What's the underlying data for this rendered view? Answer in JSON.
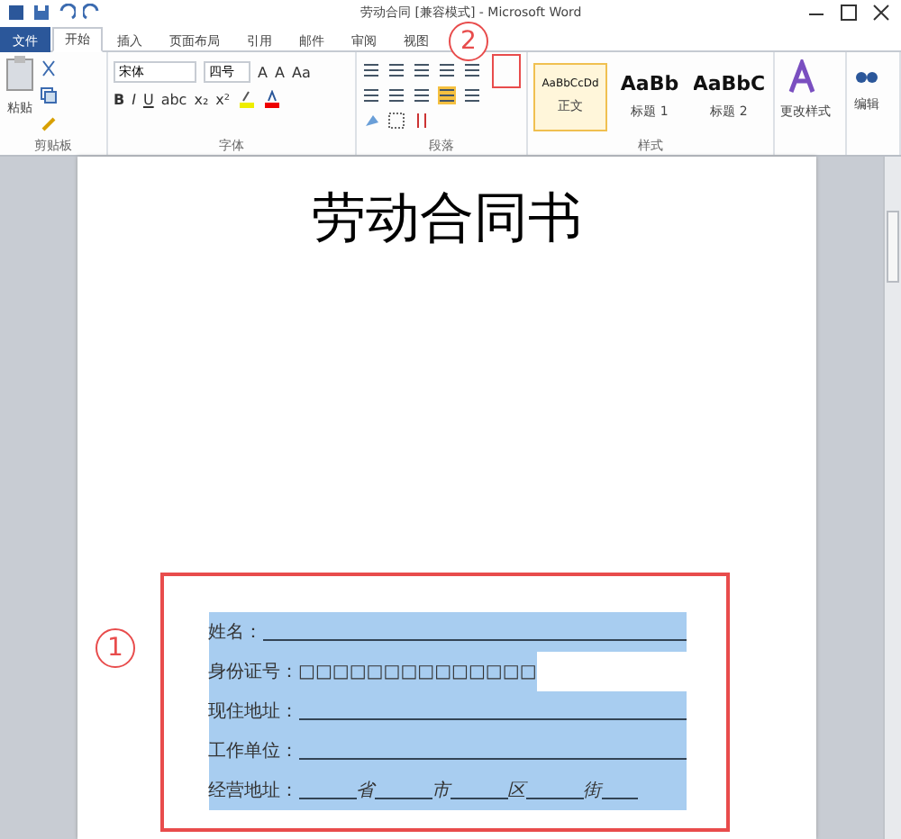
{
  "window": {
    "title": "劳动合同 [兼容模式] - Microsoft Word"
  },
  "tabs": [
    {
      "label": "文件",
      "kind": "file",
      "selected": false
    },
    {
      "label": "开始",
      "kind": "tab",
      "selected": true
    },
    {
      "label": "插入",
      "kind": "tab",
      "selected": false
    },
    {
      "label": "页面布局",
      "kind": "tab",
      "selected": false
    },
    {
      "label": "引用",
      "kind": "tab",
      "selected": false
    },
    {
      "label": "邮件",
      "kind": "tab",
      "selected": false
    },
    {
      "label": "审阅",
      "kind": "tab",
      "selected": false
    },
    {
      "label": "视图",
      "kind": "tab",
      "selected": false
    }
  ],
  "ribbon": {
    "clipboard": {
      "paste": "粘贴",
      "label": "剪贴板"
    },
    "font": {
      "name": "宋体",
      "size": "四号",
      "row1": [
        "A",
        "A",
        "Aa"
      ],
      "row2": [
        "B",
        "I",
        "U",
        "abc",
        "x₂",
        "x²"
      ],
      "label": "字体"
    },
    "paragraph": {
      "label": "段落"
    },
    "styles": {
      "items": [
        {
          "preview": "AaBbCcDd",
          "name": "正文",
          "selected": true
        },
        {
          "preview": "AaBb",
          "name": "标题 1",
          "selected": false
        },
        {
          "preview": "AaBbC",
          "name": "标题 2",
          "selected": false
        }
      ],
      "label": "样式"
    },
    "change_styles": "更改样式",
    "editing": "编辑"
  },
  "document": {
    "title": "劳动合同书",
    "form": {
      "selected": true,
      "rows": [
        {
          "kind": "line",
          "label": "姓名："
        },
        {
          "kind": "boxes",
          "label": "身份证号：",
          "boxes": "□□□□□□□□□□□□□□"
        },
        {
          "kind": "line",
          "label": "现住地址："
        },
        {
          "kind": "line",
          "label": "工作单位："
        },
        {
          "kind": "address",
          "label": "经营地址：",
          "parts": [
            "省",
            "市",
            "区",
            "街"
          ]
        }
      ]
    }
  },
  "annotations": [
    {
      "number": "1"
    },
    {
      "number": "2"
    }
  ]
}
